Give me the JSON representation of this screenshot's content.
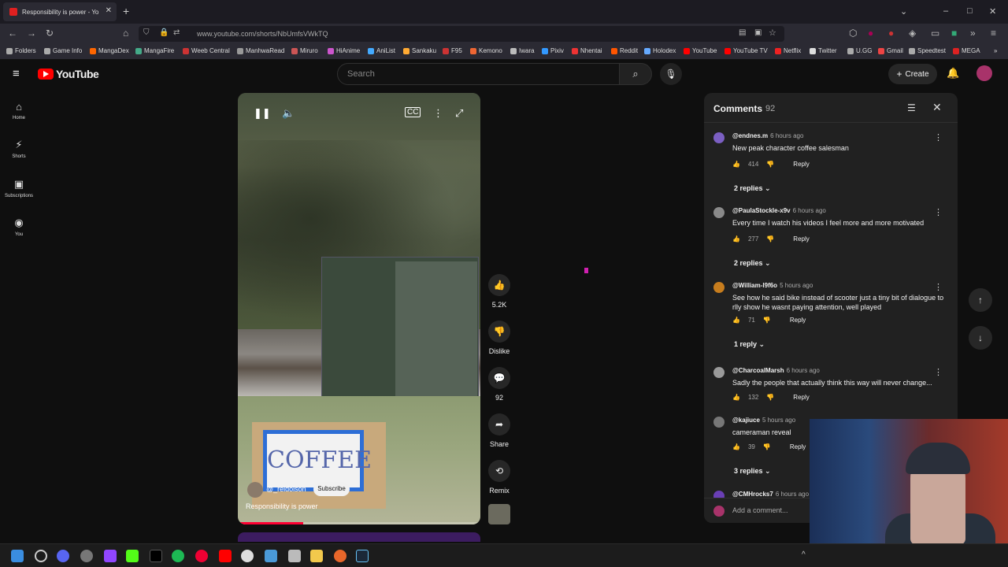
{
  "browser": {
    "tab_title": "Responsibility is power - Yo",
    "url": "www.youtube.com/shorts/NbUmfsVWkTQ",
    "bookmarks": [
      "Folders",
      "Game Info",
      "MangaDex",
      "MangaFire",
      "Weeb Central",
      "ManhwaRead",
      "Miruro",
      "HiAnime",
      "AniList",
      "Sankaku",
      "F95",
      "Kemono",
      "Iwara",
      "Pixiv",
      "Nhentai",
      "Reddit",
      "Holodex",
      "YouTube",
      "YouTube TV",
      "Netflix",
      "Twitter",
      "U.GG",
      "Gmail",
      "Speedtest",
      "MEGA"
    ]
  },
  "youtube": {
    "logo_text": "YouTube",
    "search_placeholder": "Search",
    "create_label": "Create",
    "nav": [
      "Home",
      "Shorts",
      "Subscriptions",
      "You"
    ]
  },
  "video": {
    "channel": "@_reidolson",
    "subscribe_label": "Subscribe",
    "title": "Responsibility is power",
    "sign_text": "COFFEE",
    "progress_fraction": 0.27
  },
  "actions": {
    "likes": "5.2K",
    "dislike_label": "Dislike",
    "comments_count": "92",
    "share_label": "Share",
    "remix_label": "Remix"
  },
  "comments": {
    "title": "Comments",
    "count": "92",
    "add_placeholder": "Add a comment...",
    "items": [
      {
        "user": "@endnes.m",
        "time": "6 hours ago",
        "text": "New peak character coffee salesman",
        "likes": "414",
        "replies": "2 replies",
        "avatar_color": "#7b5fc2"
      },
      {
        "user": "@PaulaStockle-x9v",
        "time": "6 hours ago",
        "text": "Every time I watch his videos I feel more and more motivated",
        "likes": "277",
        "replies": "2 replies",
        "avatar_color": "#8a8a8a"
      },
      {
        "user": "@William-l9f6o",
        "time": "5 hours ago",
        "text": "See how he said bike instead of scooter just a tiny bit of dialogue to rlly show he wasnt paying attention, well played",
        "likes": "71",
        "replies": "1 reply",
        "avatar_color": "#c77d1e"
      },
      {
        "user": "@CharcoalMarsh",
        "time": "6 hours ago",
        "text": "Sadly the people that actually think this way will never change...",
        "likes": "132",
        "replies": "",
        "avatar_color": "#9a9a9a"
      },
      {
        "user": "@kajiuce",
        "time": "5 hours ago",
        "text": "cameraman reveal",
        "likes": "39",
        "replies": "3 replies",
        "avatar_color": "#777"
      },
      {
        "user": "@CMHrocks7",
        "time": "6 hours ago",
        "text": "",
        "likes": "",
        "replies": "",
        "avatar_color": "#6a3fb5"
      }
    ],
    "reply_label": "Reply"
  }
}
